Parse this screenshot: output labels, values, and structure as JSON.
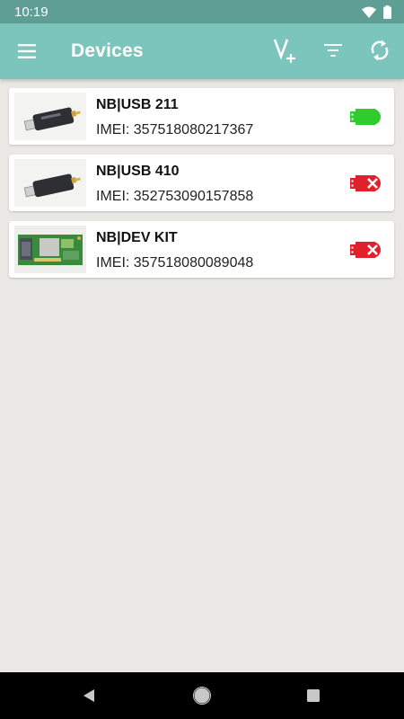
{
  "status_bar": {
    "time": "10:19",
    "icons": [
      "wifi-icon",
      "battery-icon"
    ]
  },
  "app_bar": {
    "title": "Devices",
    "actions": [
      "vplus-icon",
      "filter-icon",
      "refresh-icon"
    ]
  },
  "devices": [
    {
      "name": "NB|USB 211",
      "imei": "IMEI: 357518080217367",
      "connected": true,
      "image": "usb-stick-image"
    },
    {
      "name": "NB|USB 410",
      "imei": "IMEI: 352753090157858",
      "connected": false,
      "image": "usb-stick-image"
    },
    {
      "name": "NB|DEV KIT",
      "imei": "IMEI: 357518080089048",
      "connected": false,
      "image": "dev-kit-board-image"
    }
  ],
  "nav_bar": {
    "buttons": [
      "back-icon",
      "home-icon",
      "recent-apps-icon"
    ]
  },
  "colors": {
    "status_bar": "#5e9e95",
    "app_bar": "#7cc5bd",
    "connected": "#2ecc2e",
    "disconnected": "#e0202a",
    "background": "#e9e8e4"
  }
}
